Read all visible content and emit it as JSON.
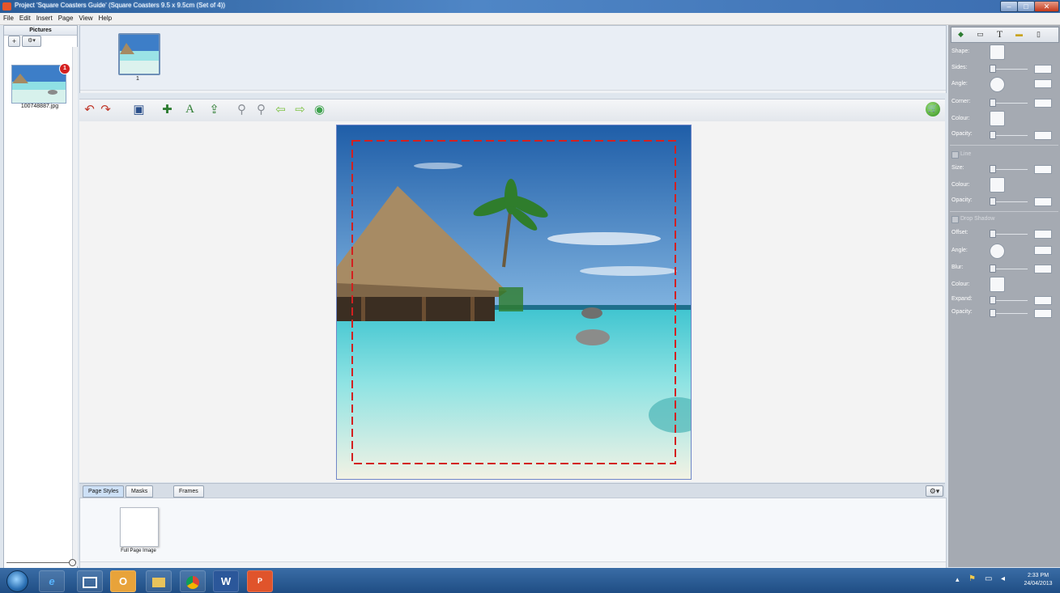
{
  "window": {
    "title": "Project 'Square Coasters Guide' (Square Coasters 9.5 x 9.5cm (Set of 4))",
    "controls": {
      "minimize": "–",
      "maximize": "□",
      "close": "✕"
    }
  },
  "menu": [
    "File",
    "Edit",
    "Insert",
    "Page",
    "View",
    "Help"
  ],
  "pictures_panel": {
    "title": "Pictures",
    "add_label": "+",
    "options_label": "⚙▾",
    "items": [
      {
        "filename": "100748887.jpg",
        "badge": "1"
      }
    ]
  },
  "pages_strip": {
    "pages": [
      {
        "number": "1"
      }
    ]
  },
  "toolbar": {
    "icons": [
      "undo-icon",
      "redo-icon",
      "save-icon",
      "add-image-icon",
      "add-text-icon",
      "export-icon",
      "zoom-out-icon",
      "zoom-in-icon",
      "previous-page-icon",
      "next-page-icon",
      "info-icon",
      "cart-icon"
    ]
  },
  "bottom_panel": {
    "tabs": [
      "Page Styles",
      "Masks",
      "Frames"
    ],
    "active_tab": "Page Styles",
    "styles": [
      {
        "label": "Full Page Image"
      }
    ]
  },
  "properties_panel": {
    "shape_section": {
      "shape": "Shape:",
      "sides": "Sides:",
      "angle": "Angle:",
      "corner": "Corner:",
      "colour": "Colour:",
      "opacity": "Opacity:"
    },
    "line_section": {
      "checkbox_label": "Line",
      "size": "Size:",
      "colour": "Colour:",
      "opacity": "Opacity:"
    },
    "shadow_section": {
      "checkbox_label": "Drop Shadow",
      "offset": "Offset:",
      "angle": "Angle:",
      "blur": "Blur:",
      "colour": "Colour:",
      "expand": "Expand:",
      "opacity": "Opacity:"
    }
  },
  "taskbar": {
    "time": "2:33 PM",
    "date": "24/04/2013",
    "apps": [
      "internet-explorer-icon",
      "desktop-icon",
      "outlook-icon",
      "file-explorer-icon",
      "chrome-icon",
      "word-icon",
      "photobook-icon"
    ],
    "app_glyphs": [
      "e",
      "",
      "O",
      "",
      "",
      "W",
      "P"
    ]
  },
  "colors": {
    "title_bar": "#2a5d99",
    "cut_line": "#d32020",
    "panel_gray": "#a5aab2"
  }
}
